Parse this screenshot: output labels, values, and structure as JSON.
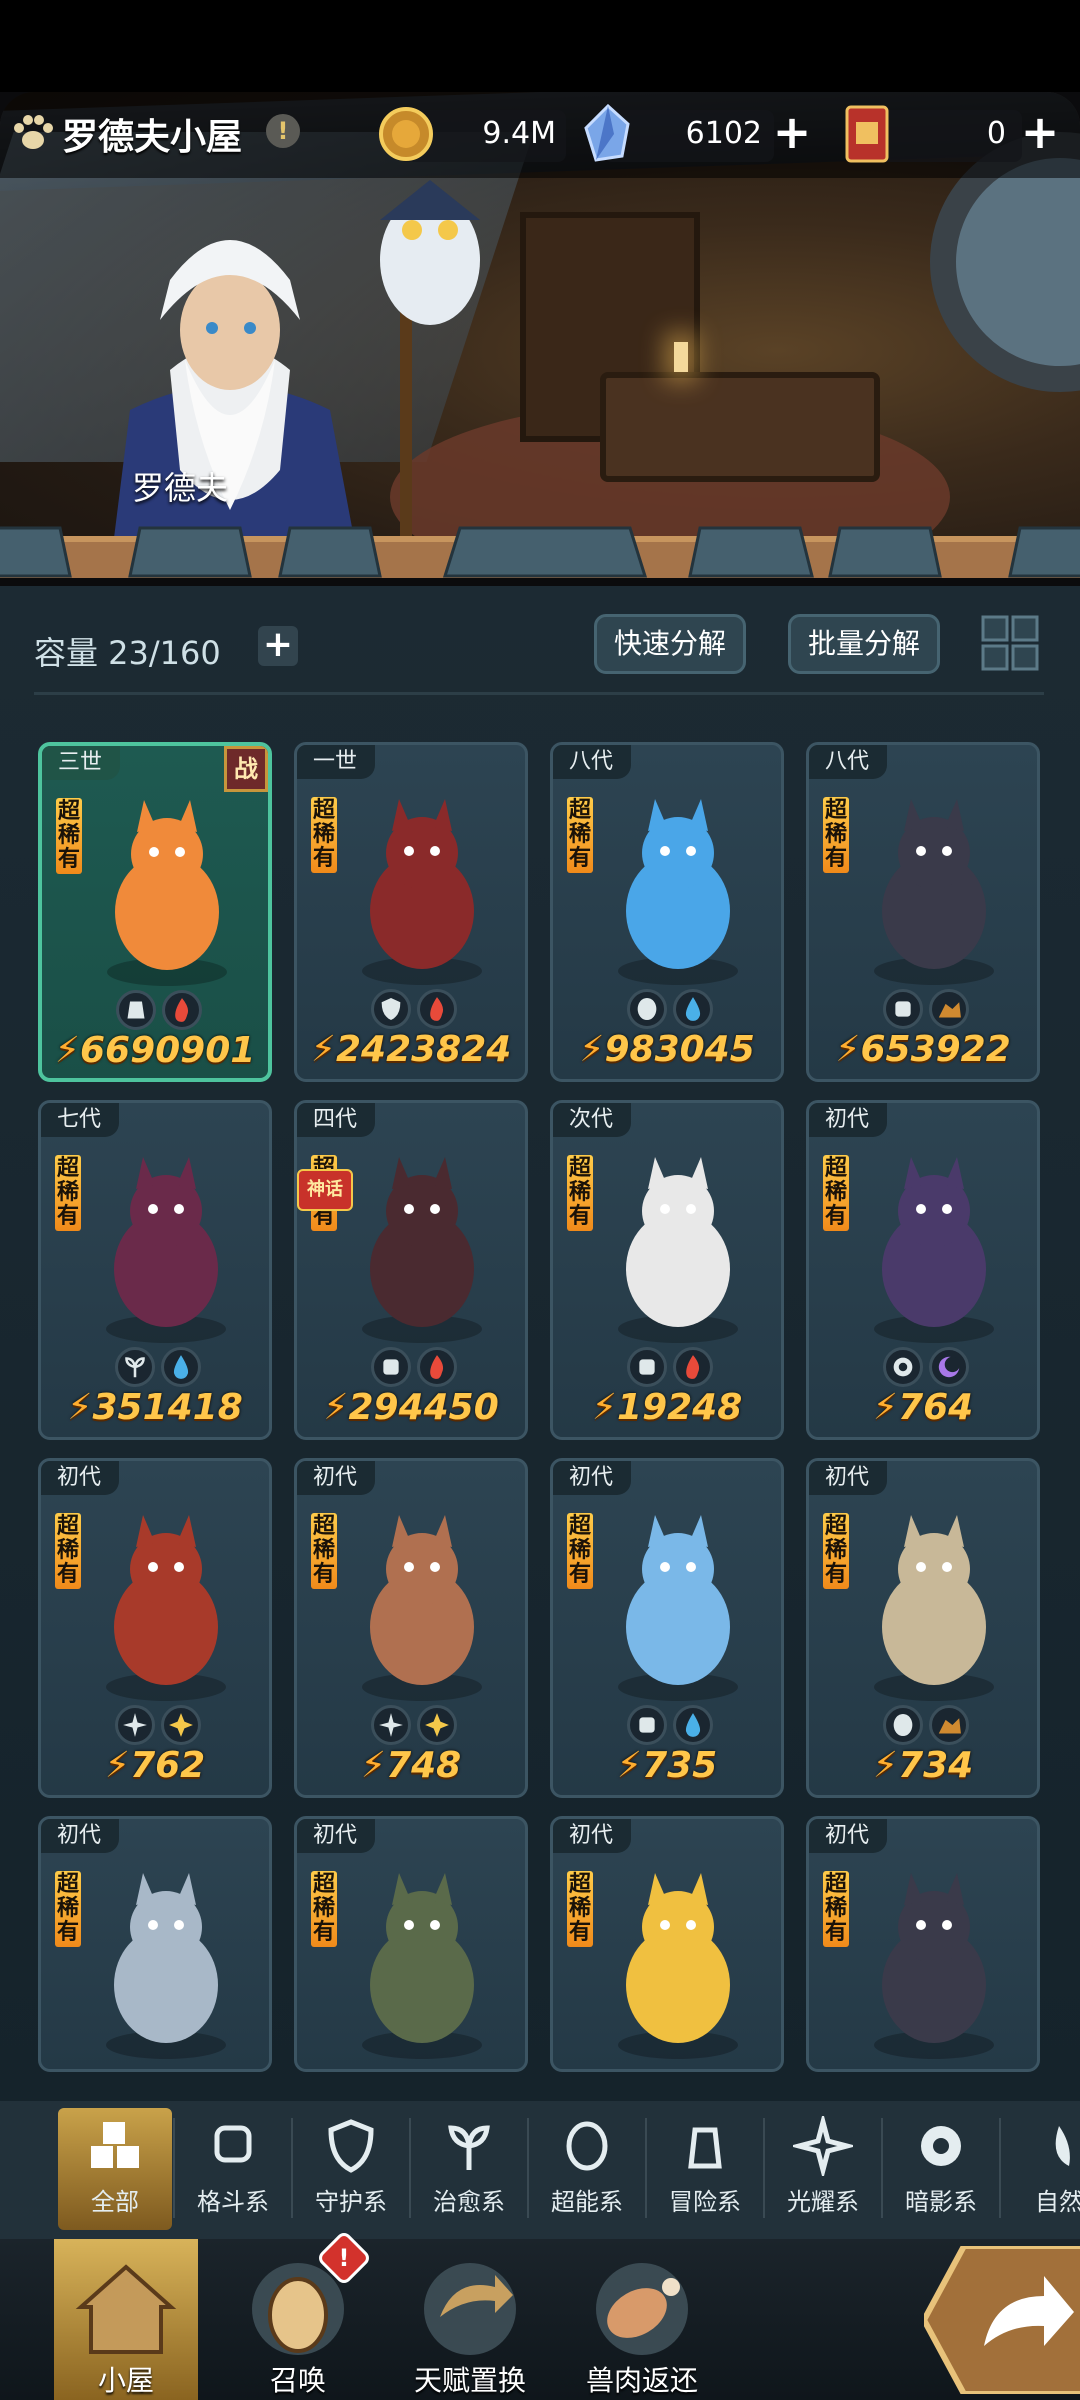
{
  "header": {
    "house_title": "罗德夫小屋",
    "alert": "!",
    "npc_name": "罗德夫"
  },
  "resources": [
    {
      "icon": "coin-icon",
      "value": "9.4M",
      "has_plus": false
    },
    {
      "icon": "crystal-icon",
      "value": "6102",
      "has_plus": true
    },
    {
      "icon": "ticket-icon",
      "value": "0",
      "has_plus": true
    }
  ],
  "inventory": {
    "capacity_label": "容量 23/160",
    "quick_dismantle": "快速分解",
    "batch_dismantle": "批量分解"
  },
  "rarity_label": "超稀有",
  "battle_label": "战",
  "myth_label": "神话",
  "cards": [
    {
      "gen": "三世",
      "power": "6690901",
      "selected": true,
      "battle": true,
      "icons": [
        "guard-icon",
        "fire-icon"
      ],
      "color": "#f08a3a"
    },
    {
      "gen": "一世",
      "power": "2423824",
      "icons": [
        "shield-icon",
        "fire-icon"
      ],
      "color": "#8a2a2a"
    },
    {
      "gen": "八代",
      "power": "983045",
      "icons": [
        "alien-icon",
        "water-icon"
      ],
      "color": "#4aa6e8"
    },
    {
      "gen": "八代",
      "power": "653922",
      "icons": [
        "fist-icon",
        "earth-icon"
      ],
      "color": "#3a3a4a"
    },
    {
      "gen": "七代",
      "power": "351418",
      "icons": [
        "leaf-icon",
        "water-icon"
      ],
      "color": "#6a2a4a"
    },
    {
      "gen": "四代",
      "power": "294450",
      "myth": true,
      "icons": [
        "fist-icon",
        "fire-icon"
      ],
      "color": "#4a2a30"
    },
    {
      "gen": "次代",
      "power": "19248",
      "icons": [
        "fist-icon",
        "fire-icon"
      ],
      "color": "#e8e8e8"
    },
    {
      "gen": "初代",
      "power": "764",
      "icons": [
        "eye-icon",
        "dark-icon"
      ],
      "color": "#4a3a6a"
    },
    {
      "gen": "初代",
      "power": "762",
      "icons": [
        "light-icon",
        "sun-icon"
      ],
      "color": "#a83a2a"
    },
    {
      "gen": "初代",
      "power": "748",
      "icons": [
        "light-icon",
        "sun-icon"
      ],
      "color": "#b07050"
    },
    {
      "gen": "初代",
      "power": "735",
      "icons": [
        "fist-icon",
        "water-icon"
      ],
      "color": "#7ab8e8"
    },
    {
      "gen": "初代",
      "power": "734",
      "icons": [
        "alien-icon",
        "earth-icon"
      ],
      "color": "#c8b898"
    },
    {
      "gen": "初代",
      "power": "",
      "icons": [],
      "color": "#a8b8c8"
    },
    {
      "gen": "初代",
      "power": "",
      "icons": [],
      "color": "#5a6a4a"
    },
    {
      "gen": "初代",
      "power": "",
      "icons": [],
      "color": "#f0c040"
    },
    {
      "gen": "初代",
      "power": "",
      "icons": [],
      "color": "#3a3a4a"
    }
  ],
  "categories": [
    {
      "label": "全部",
      "icon": "all-icon",
      "active": true
    },
    {
      "label": "格斗系",
      "icon": "fist-icon"
    },
    {
      "label": "守护系",
      "icon": "shield-icon"
    },
    {
      "label": "治愈系",
      "icon": "leaf-icon"
    },
    {
      "label": "超能系",
      "icon": "alien-icon"
    },
    {
      "label": "冒险系",
      "icon": "lantern-icon"
    },
    {
      "label": "光耀系",
      "icon": "light-icon"
    },
    {
      "label": "暗影系",
      "icon": "eye-icon"
    },
    {
      "label": "自然",
      "icon": "nature-icon"
    }
  ],
  "nav": [
    {
      "label": "小屋",
      "icon": "house-icon",
      "active": true
    },
    {
      "label": "召唤",
      "icon": "egg-icon",
      "badge": "!"
    },
    {
      "label": "天赋置换",
      "icon": "swap-icon"
    },
    {
      "label": "兽肉返还",
      "icon": "meat-icon"
    }
  ]
}
